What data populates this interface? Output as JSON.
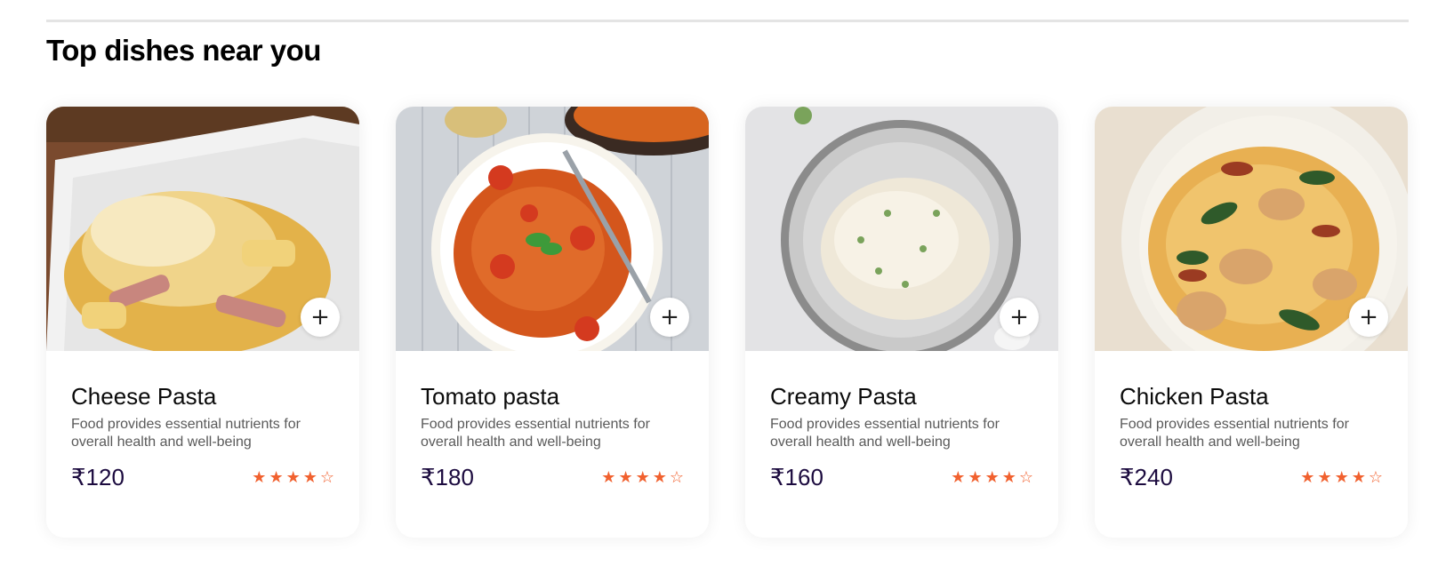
{
  "section": {
    "title": "Top dishes near you"
  },
  "dishes": [
    {
      "name": "Cheese Pasta",
      "description": "Food provides essential nutrients for overall health and well-being",
      "price": "₹120",
      "rating": 4,
      "rating_max": 5,
      "add_label": "+"
    },
    {
      "name": "Tomato pasta",
      "description": "Food provides essential nutrients for overall health and well-being",
      "price": "₹180",
      "rating": 4,
      "rating_max": 5,
      "add_label": "+"
    },
    {
      "name": "Creamy Pasta",
      "description": "Food provides essential nutrients for overall health and well-being",
      "price": "₹160",
      "rating": 4,
      "rating_max": 5,
      "add_label": "+"
    },
    {
      "name": "Chicken Pasta",
      "description": "Food provides essential nutrients for overall health and well-being",
      "price": "₹240",
      "rating": 4,
      "rating_max": 5,
      "add_label": "+"
    }
  ],
  "colors": {
    "star": "#f1612f",
    "price": "#1c0b3f"
  }
}
